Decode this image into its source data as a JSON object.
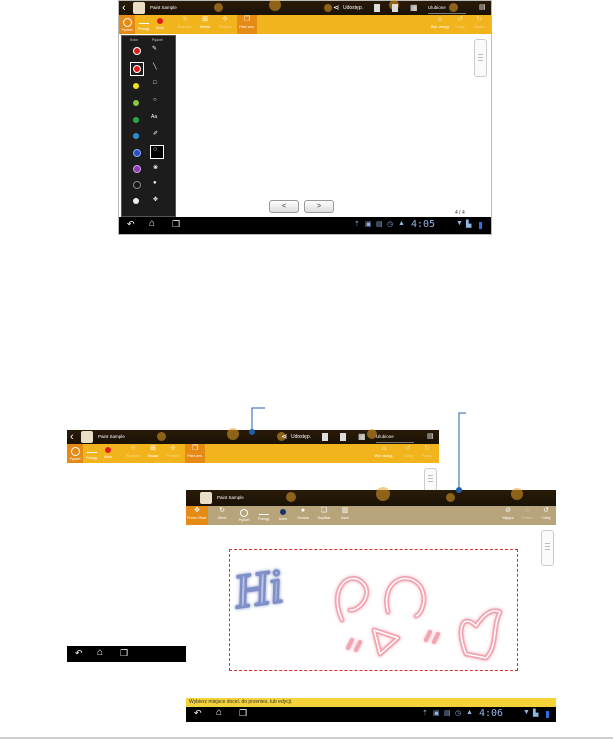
{
  "top": {
    "title": "Paint Sample",
    "share_label": "Udostęp.",
    "favorites_label": "Ulubione",
    "toolbar": [
      {
        "label": "Pędzel"
      },
      {
        "label": "Pociąg."
      },
      {
        "label": "Kolor"
      },
      {
        "label": "Rozmyw."
      },
      {
        "label": "Wstaw"
      },
      {
        "label": "Przesuń"
      },
      {
        "label": "Paint ans."
      }
    ],
    "toolbar_right": [
      {
        "label": "Wyr. wszyg."
      },
      {
        "label": "Cofnij"
      },
      {
        "label": "Ponów"
      }
    ],
    "panel": {
      "color_header": "Kolor",
      "pen_header": "Pędzel",
      "colors": [
        "#d42121",
        "#e01b1b",
        "#f3e01e",
        "#8bc83d",
        "#2aa84a",
        "#2b8fd6",
        "#2f4fb8",
        "#8e3fa8",
        "#161616",
        "#f0f0f0"
      ]
    },
    "page_counter": "4 / 4",
    "time": "4:05",
    "prev_glyph": "<",
    "next_glyph": ">"
  },
  "bottom": {
    "back": {
      "title": "Paint Sample",
      "share_label": "Udostęp.",
      "favorites_label": "Ulubione",
      "toolbar": [
        {
          "label": "Pędzel"
        },
        {
          "label": "Pociąg."
        },
        {
          "label": "Kolor"
        },
        {
          "label": "Rozmyw."
        },
        {
          "label": "Wstaw"
        },
        {
          "label": "Przesuń"
        },
        {
          "label": "Paint ans."
        }
      ],
      "toolbar_right": [
        {
          "label": "Wyr. wszyg."
        },
        {
          "label": "Cofnij"
        },
        {
          "label": "Ponów"
        }
      ]
    },
    "front": {
      "title": "Paint Sample",
      "toolbar": [
        {
          "label": "Przem./Skal."
        },
        {
          "label": "Obrót"
        },
        {
          "label": "Pędzel"
        },
        {
          "label": "Pociąg."
        },
        {
          "label": "Kolor"
        },
        {
          "label": "Gumka"
        },
        {
          "label": "Duplikat"
        },
        {
          "label": "Usuń"
        }
      ],
      "toolbar_right": [
        {
          "label": "Wyłącz"
        },
        {
          "label": "Ponów"
        },
        {
          "label": "Cofnij"
        }
      ],
      "hint": "Wybierz miejsce docel. do przenies. lub edycji.",
      "time": "4:06",
      "sketch_text": "Hi"
    }
  },
  "colors": {
    "action_bar": "#24170a",
    "toolbar": "#f2b41d",
    "toolbar_active": "#e58a14",
    "front_toolbar": "#b8a47a",
    "selection": "#d8302c",
    "callout": "#1f5fa8",
    "status_icons": "#8fb7e8"
  }
}
